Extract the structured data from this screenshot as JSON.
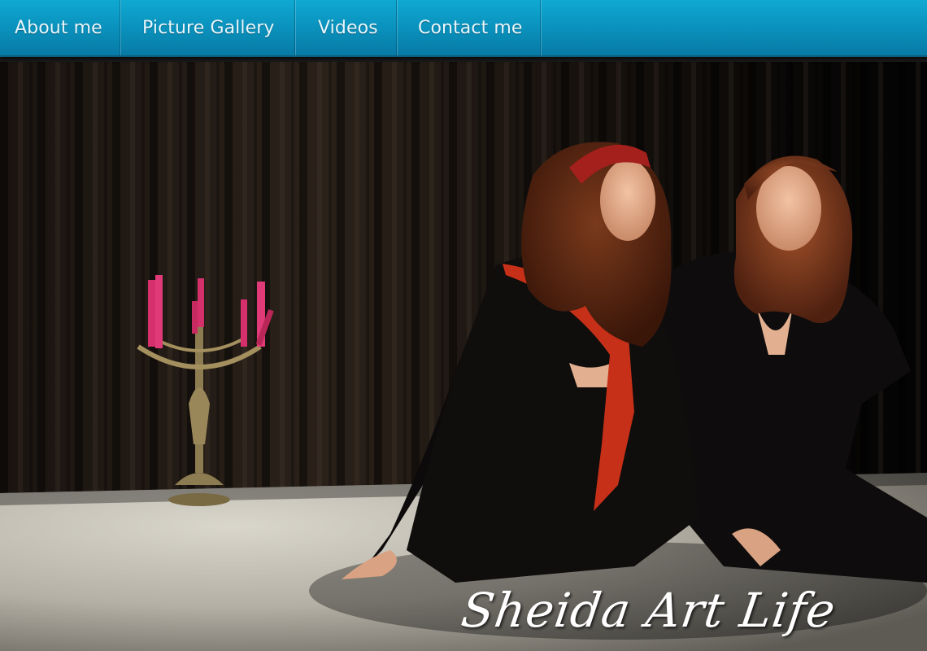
{
  "nav": {
    "items": [
      {
        "label": "About me"
      },
      {
        "label": "Picture Gallery"
      },
      {
        "label": "Videos"
      },
      {
        "label": "Contact me"
      }
    ]
  },
  "hero": {
    "title": "Sheida Art Life",
    "image_icon": "stage-performance-photo"
  },
  "colors": {
    "nav_bg": "#0a94bf",
    "nav_text": "#e8f6fc",
    "title_text": "#ffffff"
  }
}
